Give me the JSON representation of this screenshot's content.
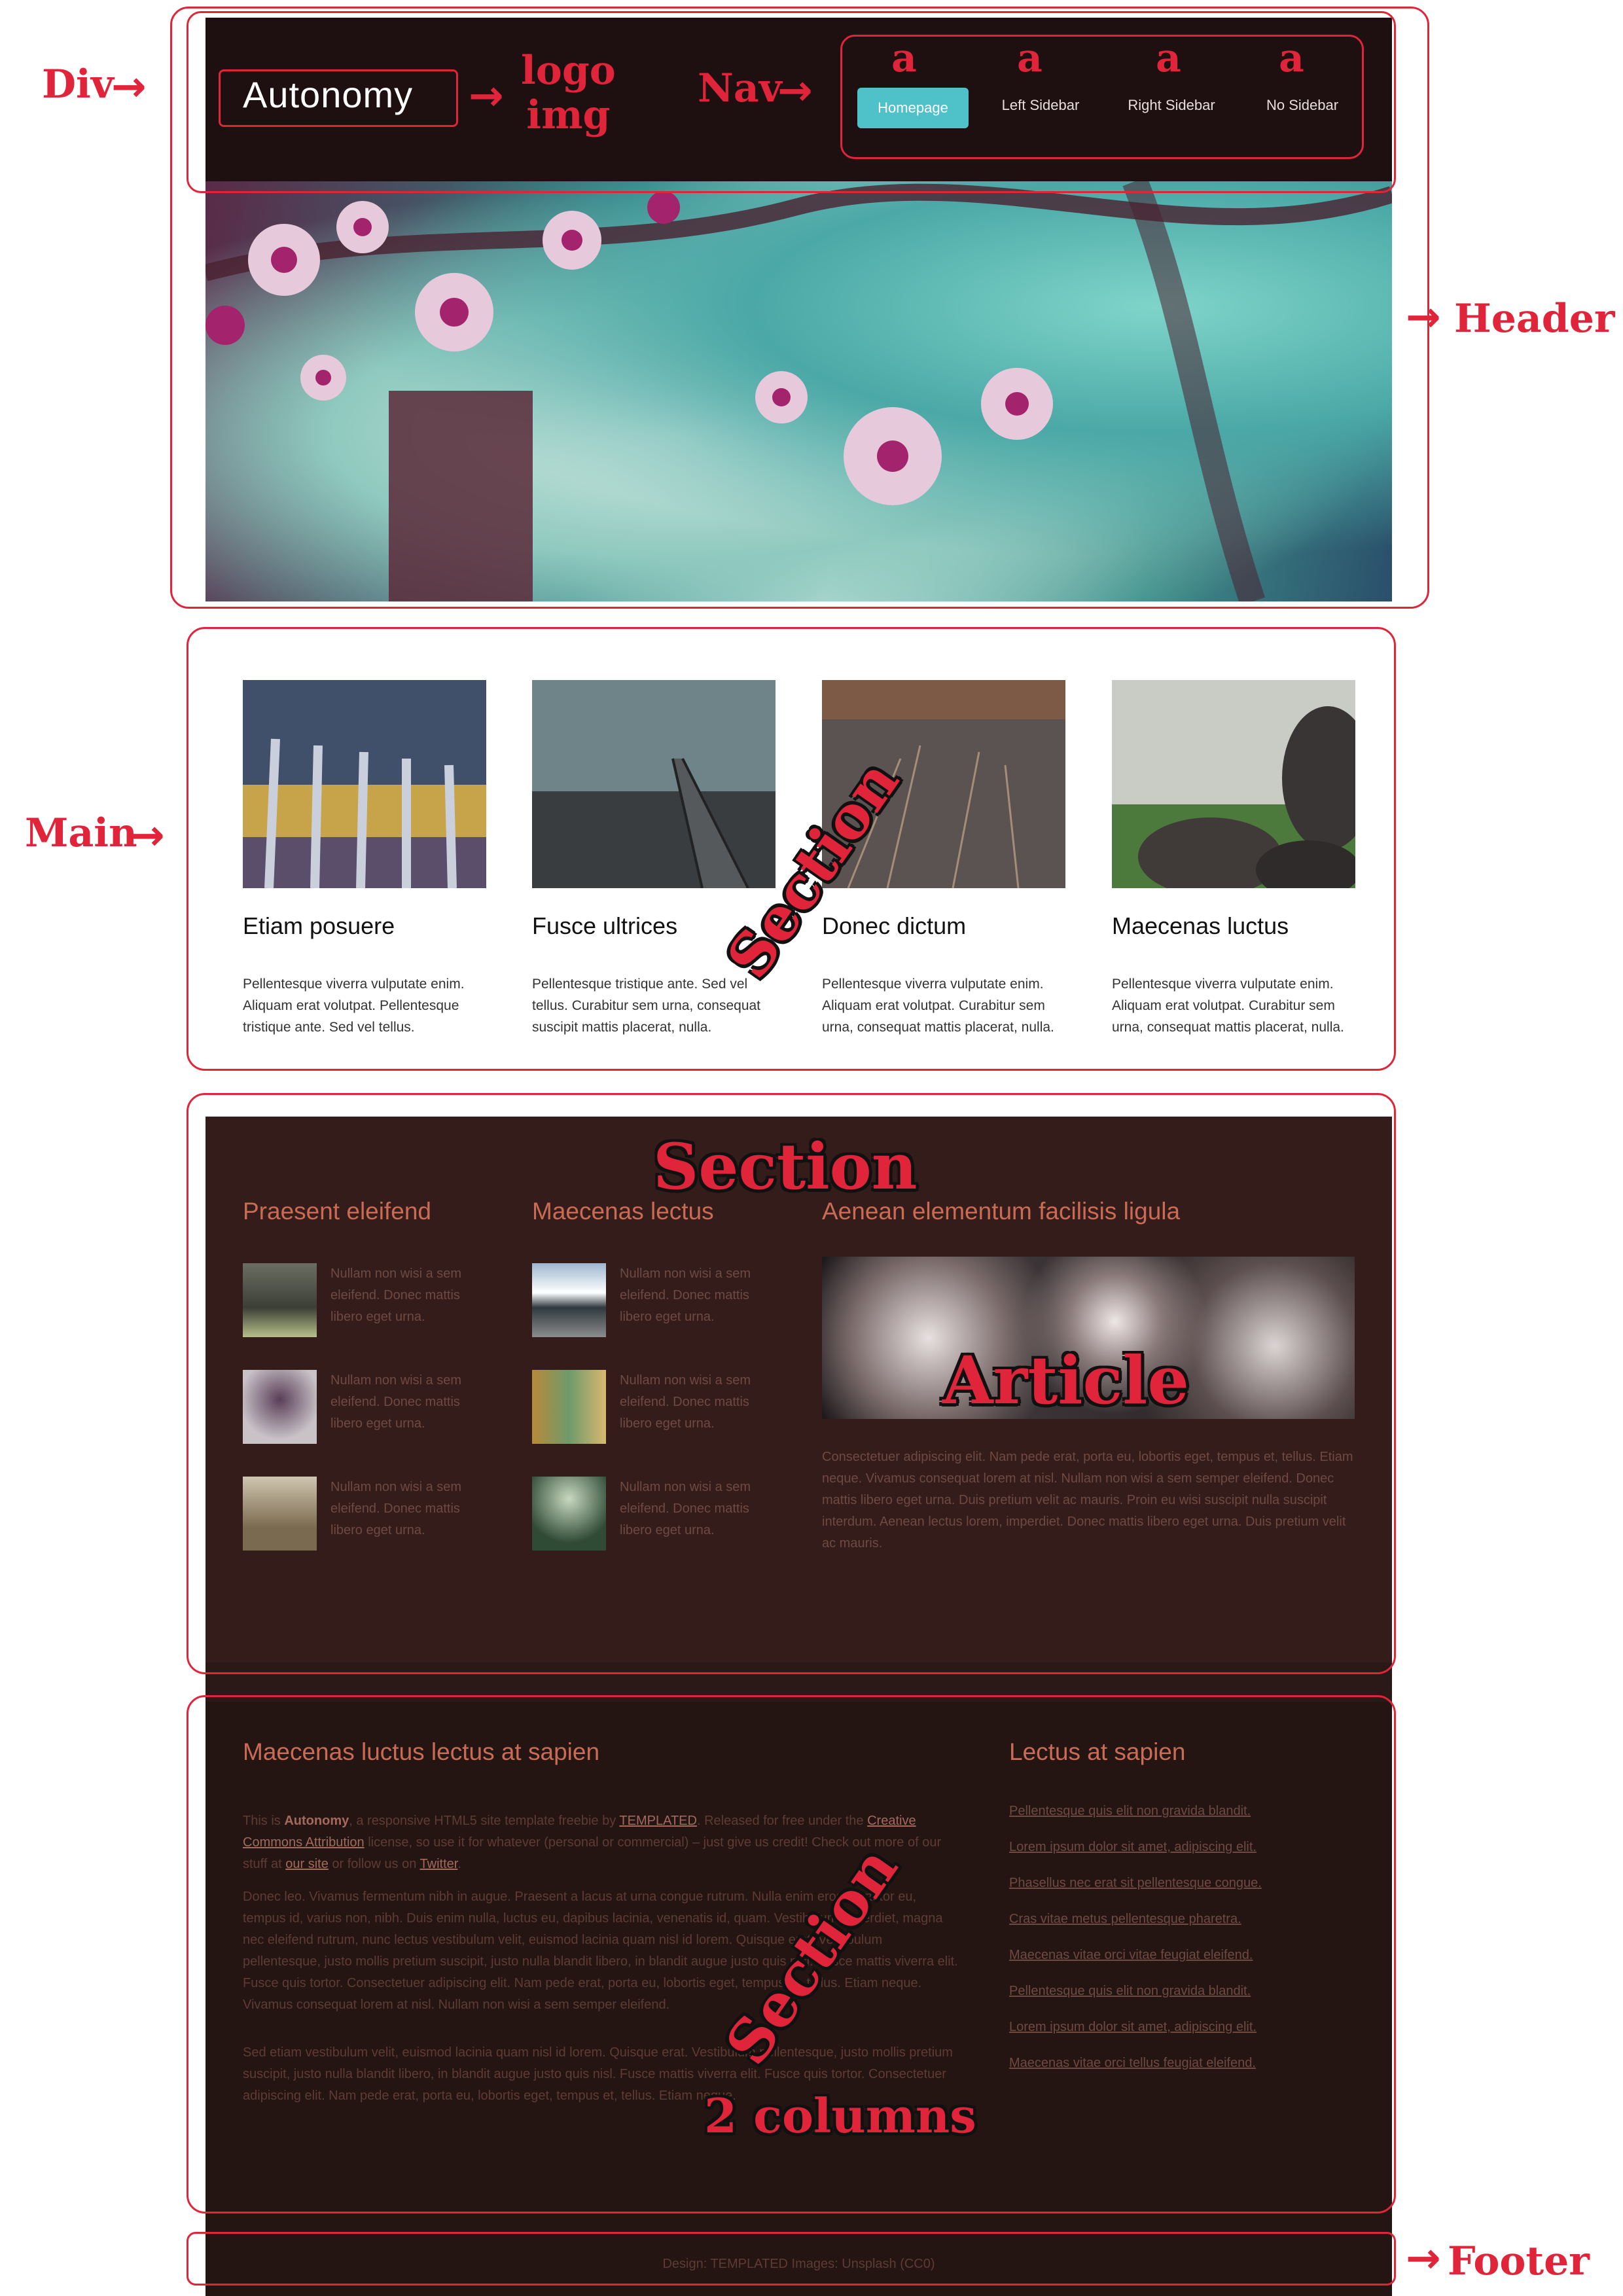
{
  "site": {
    "logo": "Autonomy",
    "nav": [
      "Homepage",
      "Left Sidebar",
      "Right Sidebar",
      "No Sidebar"
    ]
  },
  "cards": [
    {
      "title": "Etiam posuere",
      "text": "Pellentesque viverra vulputate enim. Aliquam erat volutpat. Pellentesque tristique ante. Sed vel tellus."
    },
    {
      "title": "Fusce ultrices",
      "text": "Pellentesque tristique ante. Sed vel tellus. Curabitur sem urna, consequat suscipit mattis placerat, nulla."
    },
    {
      "title": "Donec dictum",
      "text": "Pellentesque viverra vulputate enim. Aliquam erat volutpat. Curabitur sem urna, consequat mattis placerat, nulla."
    },
    {
      "title": "Maecenas luctus",
      "text": "Pellentesque viverra vulputate enim. Aliquam erat volutpat. Curabitur sem urna, consequat mattis placerat, nulla."
    }
  ],
  "dark_section": {
    "col1_heading": "Praesent eleifend",
    "col2_heading": "Maecenas lectus",
    "col3_heading": "Aenean elementum facilisis ligula",
    "thumb_text": "Nullam non wisi a sem eleifend. Donec mattis libero eget urna.",
    "article_text": "Consectetuer adipiscing elit. Nam pede erat, porta eu, lobortis eget, tempus et, tellus. Etiam neque. Vivamus consequat lorem at nisl. Nullam non wisi a sem semper eleifend. Donec mattis libero eget urna. Duis pretium velit ac mauris. Proin eu wisi suscipit nulla suscipit interdum. Aenean lectus lorem, imperdiet. Donec mattis libero eget urna. Duis pretium velit ac mauris."
  },
  "bottom_section": {
    "heading_left": "Maecenas luctus lectus at sapien",
    "heading_right": "Lectus at sapien",
    "intro": {
      "t1": "This is ",
      "name": "Autonomy",
      "t2": ", a responsive HTML5 site template freebie by ",
      "link1": "TEMPLATED",
      "t3": ". Released for free under the ",
      "link2": "Creative Commons Attribution",
      "t4": " license, so use it for whatever (personal or commercial) – just give us credit! Check out more of our stuff at ",
      "link3": "our site",
      "t5": " or follow us on ",
      "link4": "Twitter",
      "t6": "."
    },
    "para2": "Donec leo. Vivamus fermentum nibh in augue. Praesent a lacus at urna congue rutrum. Nulla enim eros, porttitor eu, tempus id, varius non, nibh. Duis enim nulla, luctus eu, dapibus lacinia, venenatis id, quam. Vestibulum imperdiet, magna nec eleifend rutrum, nunc lectus vestibulum velit, euismod lacinia quam nisl id lorem. Quisque erat. Vestibulum pellentesque, justo mollis pretium suscipit, justo nulla blandit libero, in blandit augue justo quis nisl. Fusce mattis viverra elit. Fusce quis tortor. Consectetuer adipiscing elit. Nam pede erat, porta eu, lobortis eget, tempus et, tellus. Etiam neque. Vivamus consequat lorem at nisl. Nullam non wisi a sem semper eleifend.",
    "para3": "Sed etiam vestibulum velit, euismod lacinia quam nisl id lorem. Quisque erat. Vestibulum pellentesque, justo mollis pretium suscipit, justo nulla blandit libero, in blandit augue justo quis nisl. Fusce mattis viverra elit. Fusce quis tortor. Consectetuer adipiscing elit. Nam pede erat, porta eu, lobortis eget, tempus et, tellus. Etiam neque.",
    "links": [
      "Pellentesque quis elit non gravida blandit.",
      "Lorem ipsum dolor sit amet, adipiscing elit.",
      "Phasellus nec erat sit pellentesque congue.",
      "Cras vitae metus pellentesque pharetra.",
      "Maecenas vitae orci vitae feugiat eleifend.",
      "Pellentesque quis elit non gravida blandit.",
      "Lorem ipsum dolor sit amet, adipiscing elit.",
      "Maecenas vitae orci tellus feugiat eleifend."
    ]
  },
  "footer": "Design: TEMPLATED Images: Unsplash (CC0)",
  "annotations": {
    "div": "Div",
    "logo_line1": "logo",
    "logo_line2": "img",
    "nav": "Nav",
    "a": "a",
    "header": "Header",
    "main": "Main",
    "section": "Section",
    "article": "Article",
    "two_columns": "2 columns",
    "footer": "Footer",
    "arrow": "→"
  },
  "colors": {
    "annotation": "#e0253a",
    "header_bg": "#1e1010",
    "nav_active": "#4fc1c9",
    "section_dark": "#331c19",
    "section_darker": "#241513",
    "accent_heading": "#c96b55"
  }
}
